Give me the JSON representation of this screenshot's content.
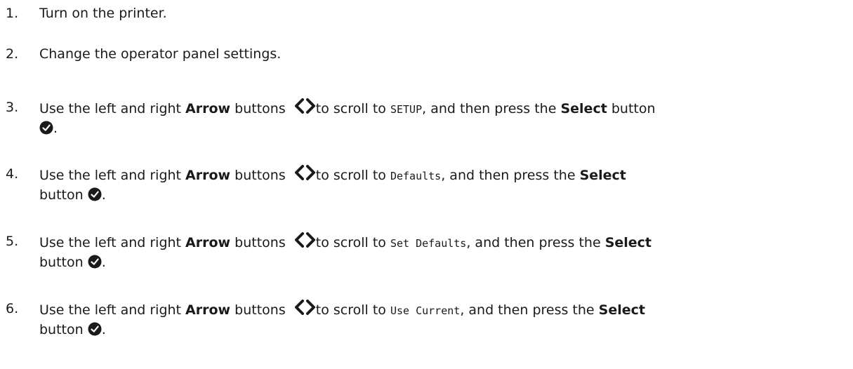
{
  "steps": [
    {
      "number": "1.",
      "text": "Turn on the printer."
    },
    {
      "number": "2.",
      "text": "Change the operator panel settings."
    },
    {
      "number": "3.",
      "pre": "Use the left and right ",
      "bold1": "Arrow",
      "mid1": " buttons ",
      "mid2": "to scroll to ",
      "code": "SETUP",
      "mid3": ", and then press the ",
      "bold2": "Select",
      "post": " button",
      "end": "."
    },
    {
      "number": "4.",
      "pre": "Use the left and right ",
      "bold1": "Arrow",
      "mid1": " buttons ",
      "mid2": "to scroll to ",
      "code": "Defaults",
      "mid3": ", and then press the ",
      "bold2": "Select",
      "post": "button ",
      "end": "."
    },
    {
      "number": "5.",
      "pre": "Use the left and right ",
      "bold1": "Arrow",
      "mid1": " buttons ",
      "mid2": "to scroll to ",
      "code": "Set Defaults",
      "mid3": ", and then press the ",
      "bold2": "Select",
      "post": "button ",
      "end": "."
    },
    {
      "number": "6.",
      "pre": "Use the left and right ",
      "bold1": "Arrow",
      "mid1": " buttons ",
      "mid2": "to scroll to ",
      "code": "Use Current",
      "mid3": ", and then press the ",
      "bold2": "Select",
      "post": "button ",
      "end": "."
    }
  ],
  "icons": {
    "arrows": "left-right-arrow-buttons-icon",
    "select": "select-checkmark-icon",
    "icon_color": "#1a1a1a"
  }
}
